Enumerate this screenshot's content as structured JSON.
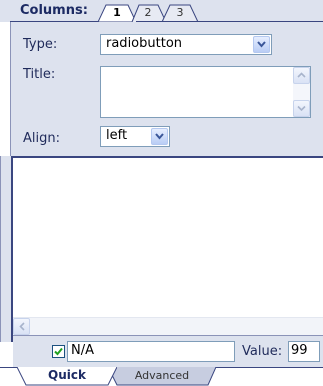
{
  "header": {
    "title": "Columns:",
    "tabs": [
      {
        "label": "1",
        "active": true
      },
      {
        "label": "2",
        "active": false
      },
      {
        "label": "3",
        "active": false
      }
    ]
  },
  "form": {
    "type_label": "Type:",
    "type_value": "radiobutton",
    "title_label": "Title:",
    "title_value": "",
    "align_label": "Align:",
    "align_value": "left"
  },
  "footer": {
    "checkbox_checked": true,
    "na_value": "N/A",
    "value_label": "Value:",
    "value_value": "99"
  },
  "bottom_tabs": [
    {
      "label": "Quick",
      "active": true
    },
    {
      "label": "Advanced",
      "active": false
    }
  ],
  "colors": {
    "panel_bg": "#dde2ee",
    "title_text": "#1c2a63",
    "input_border": "#7f9db9",
    "frame_dark": "#3a4680"
  },
  "icons": {
    "dropdown": "chevron-down-icon",
    "scroll_up": "arrow-up-icon",
    "scroll_down": "arrow-down-icon",
    "scroll_left": "arrow-left-icon",
    "checkbox": "checkmark-icon"
  }
}
